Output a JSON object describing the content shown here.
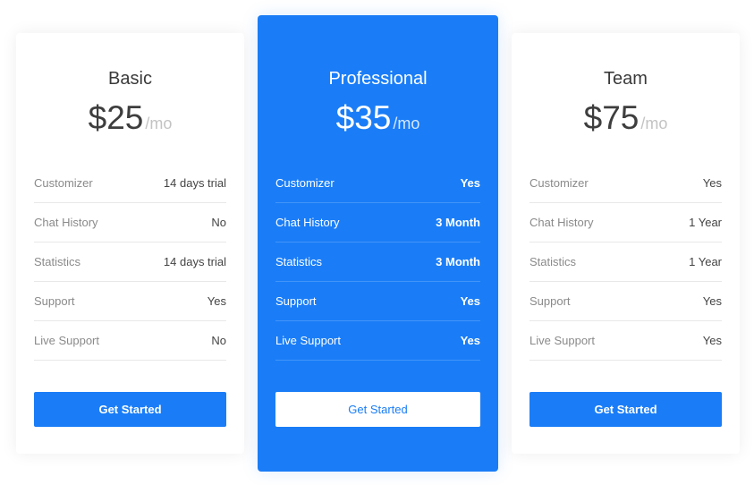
{
  "plans": [
    {
      "name": "Basic",
      "price": "$25",
      "period": "/mo",
      "features": [
        {
          "label": "Customizer",
          "value": "14 days trial"
        },
        {
          "label": "Chat History",
          "value": "No"
        },
        {
          "label": "Statistics",
          "value": "14 days trial"
        },
        {
          "label": "Support",
          "value": "Yes"
        },
        {
          "label": "Live Support",
          "value": "No"
        }
      ],
      "cta": "Get Started"
    },
    {
      "name": "Professional",
      "price": "$35",
      "period": "/mo",
      "features": [
        {
          "label": "Customizer",
          "value": "Yes"
        },
        {
          "label": "Chat History",
          "value": "3 Month"
        },
        {
          "label": "Statistics",
          "value": "3 Month"
        },
        {
          "label": "Support",
          "value": "Yes"
        },
        {
          "label": "Live Support",
          "value": "Yes"
        }
      ],
      "cta": "Get Started"
    },
    {
      "name": "Team",
      "price": "$75",
      "period": "/mo",
      "features": [
        {
          "label": "Customizer",
          "value": "Yes"
        },
        {
          "label": "Chat History",
          "value": "1 Year"
        },
        {
          "label": "Statistics",
          "value": "1 Year"
        },
        {
          "label": "Support",
          "value": "Yes"
        },
        {
          "label": "Live Support",
          "value": "Yes"
        }
      ],
      "cta": "Get Started"
    }
  ],
  "colors": {
    "accent": "#1a7df7",
    "text_dark": "#3e3e3e",
    "text_muted": "#8a8a8a",
    "period_muted": "#c3c3c3"
  }
}
